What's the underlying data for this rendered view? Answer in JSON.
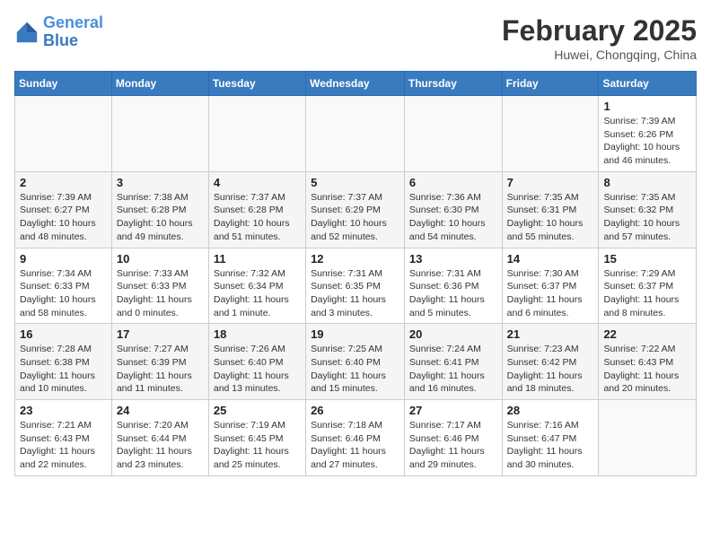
{
  "header": {
    "logo_line1": "General",
    "logo_line2": "Blue",
    "month_year": "February 2025",
    "location": "Huwei, Chongqing, China"
  },
  "weekdays": [
    "Sunday",
    "Monday",
    "Tuesday",
    "Wednesday",
    "Thursday",
    "Friday",
    "Saturday"
  ],
  "weeks": [
    [
      {
        "day": "",
        "detail": ""
      },
      {
        "day": "",
        "detail": ""
      },
      {
        "day": "",
        "detail": ""
      },
      {
        "day": "",
        "detail": ""
      },
      {
        "day": "",
        "detail": ""
      },
      {
        "day": "",
        "detail": ""
      },
      {
        "day": "1",
        "detail": "Sunrise: 7:39 AM\nSunset: 6:26 PM\nDaylight: 10 hours\nand 46 minutes."
      }
    ],
    [
      {
        "day": "2",
        "detail": "Sunrise: 7:39 AM\nSunset: 6:27 PM\nDaylight: 10 hours\nand 48 minutes."
      },
      {
        "day": "3",
        "detail": "Sunrise: 7:38 AM\nSunset: 6:28 PM\nDaylight: 10 hours\nand 49 minutes."
      },
      {
        "day": "4",
        "detail": "Sunrise: 7:37 AM\nSunset: 6:28 PM\nDaylight: 10 hours\nand 51 minutes."
      },
      {
        "day": "5",
        "detail": "Sunrise: 7:37 AM\nSunset: 6:29 PM\nDaylight: 10 hours\nand 52 minutes."
      },
      {
        "day": "6",
        "detail": "Sunrise: 7:36 AM\nSunset: 6:30 PM\nDaylight: 10 hours\nand 54 minutes."
      },
      {
        "day": "7",
        "detail": "Sunrise: 7:35 AM\nSunset: 6:31 PM\nDaylight: 10 hours\nand 55 minutes."
      },
      {
        "day": "8",
        "detail": "Sunrise: 7:35 AM\nSunset: 6:32 PM\nDaylight: 10 hours\nand 57 minutes."
      }
    ],
    [
      {
        "day": "9",
        "detail": "Sunrise: 7:34 AM\nSunset: 6:33 PM\nDaylight: 10 hours\nand 58 minutes."
      },
      {
        "day": "10",
        "detail": "Sunrise: 7:33 AM\nSunset: 6:33 PM\nDaylight: 11 hours\nand 0 minutes."
      },
      {
        "day": "11",
        "detail": "Sunrise: 7:32 AM\nSunset: 6:34 PM\nDaylight: 11 hours\nand 1 minute."
      },
      {
        "day": "12",
        "detail": "Sunrise: 7:31 AM\nSunset: 6:35 PM\nDaylight: 11 hours\nand 3 minutes."
      },
      {
        "day": "13",
        "detail": "Sunrise: 7:31 AM\nSunset: 6:36 PM\nDaylight: 11 hours\nand 5 minutes."
      },
      {
        "day": "14",
        "detail": "Sunrise: 7:30 AM\nSunset: 6:37 PM\nDaylight: 11 hours\nand 6 minutes."
      },
      {
        "day": "15",
        "detail": "Sunrise: 7:29 AM\nSunset: 6:37 PM\nDaylight: 11 hours\nand 8 minutes."
      }
    ],
    [
      {
        "day": "16",
        "detail": "Sunrise: 7:28 AM\nSunset: 6:38 PM\nDaylight: 11 hours\nand 10 minutes."
      },
      {
        "day": "17",
        "detail": "Sunrise: 7:27 AM\nSunset: 6:39 PM\nDaylight: 11 hours\nand 11 minutes."
      },
      {
        "day": "18",
        "detail": "Sunrise: 7:26 AM\nSunset: 6:40 PM\nDaylight: 11 hours\nand 13 minutes."
      },
      {
        "day": "19",
        "detail": "Sunrise: 7:25 AM\nSunset: 6:40 PM\nDaylight: 11 hours\nand 15 minutes."
      },
      {
        "day": "20",
        "detail": "Sunrise: 7:24 AM\nSunset: 6:41 PM\nDaylight: 11 hours\nand 16 minutes."
      },
      {
        "day": "21",
        "detail": "Sunrise: 7:23 AM\nSunset: 6:42 PM\nDaylight: 11 hours\nand 18 minutes."
      },
      {
        "day": "22",
        "detail": "Sunrise: 7:22 AM\nSunset: 6:43 PM\nDaylight: 11 hours\nand 20 minutes."
      }
    ],
    [
      {
        "day": "23",
        "detail": "Sunrise: 7:21 AM\nSunset: 6:43 PM\nDaylight: 11 hours\nand 22 minutes."
      },
      {
        "day": "24",
        "detail": "Sunrise: 7:20 AM\nSunset: 6:44 PM\nDaylight: 11 hours\nand 23 minutes."
      },
      {
        "day": "25",
        "detail": "Sunrise: 7:19 AM\nSunset: 6:45 PM\nDaylight: 11 hours\nand 25 minutes."
      },
      {
        "day": "26",
        "detail": "Sunrise: 7:18 AM\nSunset: 6:46 PM\nDaylight: 11 hours\nand 27 minutes."
      },
      {
        "day": "27",
        "detail": "Sunrise: 7:17 AM\nSunset: 6:46 PM\nDaylight: 11 hours\nand 29 minutes."
      },
      {
        "day": "28",
        "detail": "Sunrise: 7:16 AM\nSunset: 6:47 PM\nDaylight: 11 hours\nand 30 minutes."
      },
      {
        "day": "",
        "detail": ""
      }
    ]
  ]
}
